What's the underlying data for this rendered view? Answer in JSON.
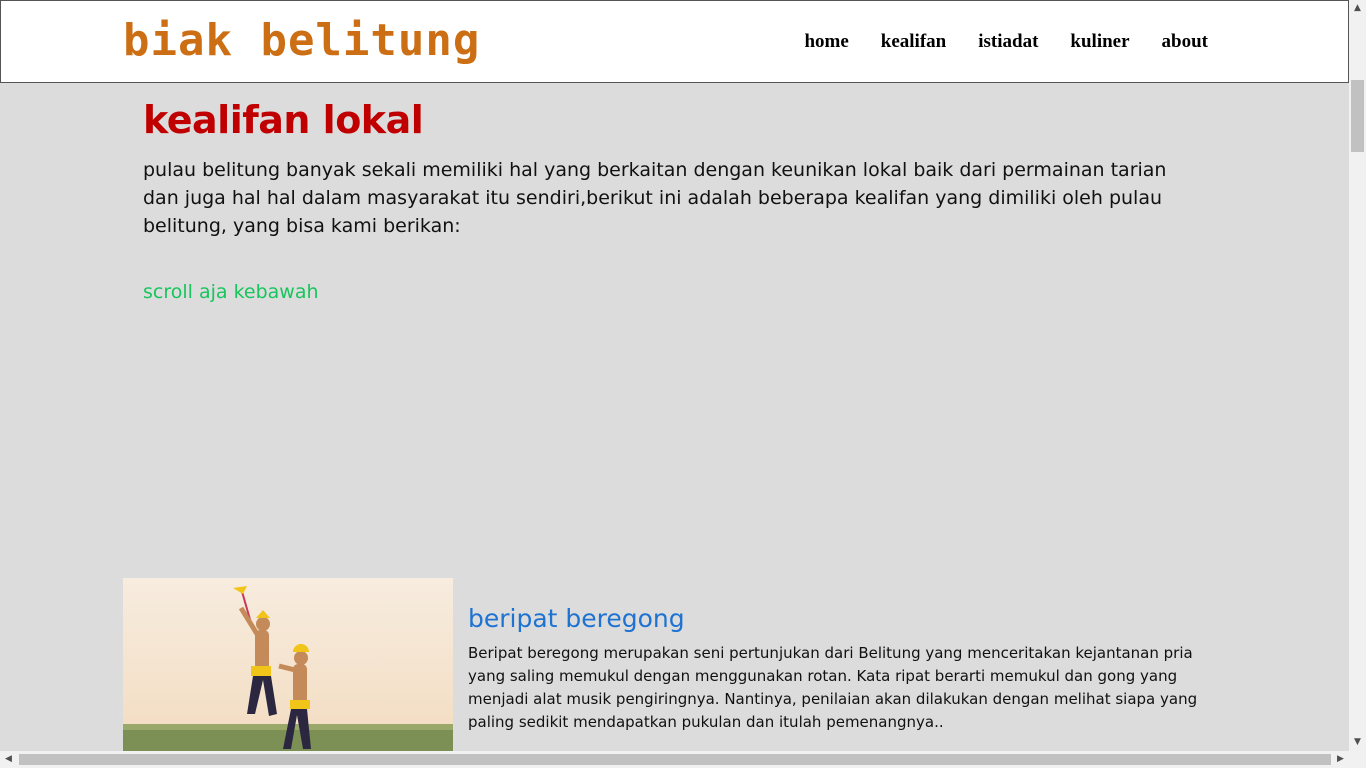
{
  "site": {
    "logo": "biak belitung"
  },
  "nav": {
    "items": [
      {
        "label": "home"
      },
      {
        "label": "kealifan"
      },
      {
        "label": "istiadat"
      },
      {
        "label": "kuliner"
      },
      {
        "label": "about"
      }
    ]
  },
  "main": {
    "title": "kealifan lokal",
    "intro": "pulau belitung banyak sekali memiliki hal yang berkaitan dengan keunikan lokal baik dari permainan tarian dan juga hal hal dalam masyarakat itu sendiri,berikut ini adalah beberapa kealifan yang dimiliki oleh pulau belitung, yang bisa kami berikan:",
    "scroll_hint": "scroll aja kebawah"
  },
  "article": {
    "title": "beripat beregong",
    "text": "Beripat beregong merupakan seni pertunjukan dari Belitung yang menceritakan kejantanan pria yang saling memukul dengan menggunakan rotan. Kata ripat berarti memukul dan gong yang menjadi alat musik pengiringnya. Nantinya, penilaian akan dilakukan dengan melihat siapa yang paling sedikit mendapatkan pukulan dan itulah pemenangnya.."
  },
  "colors": {
    "logo": "#cc6e14",
    "title": "#c00000",
    "scroll_hint": "#17c55c",
    "article_title": "#1e73d2",
    "background": "#dcdcdc"
  }
}
